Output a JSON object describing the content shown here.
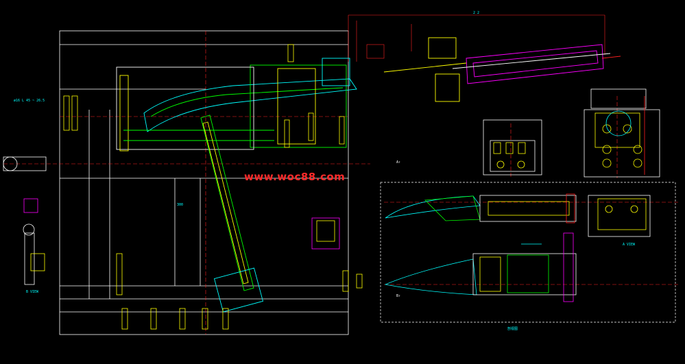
{
  "watermark": "www.woc88.com",
  "colors": {
    "background": "#000000",
    "outline": "#ffffff",
    "red": "#ff2020",
    "green": "#00ff00",
    "yellow": "#ffff00",
    "cyan": "#00ffff",
    "magenta": "#ff00ff",
    "blue": "#3050ff"
  },
  "labels": {
    "b_view": "B VIEW",
    "a_view": "A VIEW",
    "section_cap": "剖视图",
    "note_top": "2 2",
    "spec_left": "ø16 L 45 ~ 26.5",
    "dim_right": "300",
    "tag_a": "A↑",
    "tag_b": "B↑"
  }
}
